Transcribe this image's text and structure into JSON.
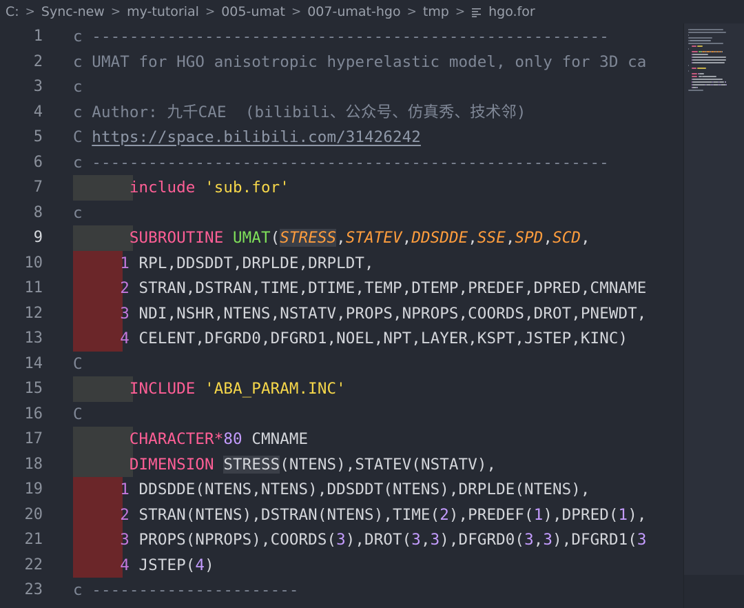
{
  "breadcrumb": {
    "items": [
      "C:",
      "Sync-new",
      "my-tutorial",
      "005-umat",
      "007-umat-hgo",
      "tmp"
    ],
    "separator": ">",
    "file": "hgo.for",
    "file_icon": "file-lines-icon"
  },
  "editor": {
    "active_line": 9,
    "lines": [
      {
        "n": "1",
        "tokens": [
          [
            "c",
            "comment"
          ],
          [
            " -------------------------------------------------------",
            "comment"
          ]
        ]
      },
      {
        "n": "2",
        "tokens": [
          [
            "c UMAT for HGO anisotropic hyperelastic model, only for 3D ca",
            "comment"
          ]
        ]
      },
      {
        "n": "3",
        "tokens": [
          [
            "c",
            "comment"
          ]
        ]
      },
      {
        "n": "4",
        "tokens": [
          [
            "c Author: 九千CAE  (bilibili、公众号、仿真秀、技术邻)",
            "comment"
          ]
        ]
      },
      {
        "n": "5",
        "tokens": [
          [
            "C ",
            "comment"
          ],
          [
            "https://space.bilibili.com/31426242",
            "link"
          ]
        ]
      },
      {
        "n": "6",
        "tokens": [
          [
            "c -------------------------------------------------------",
            "comment"
          ]
        ]
      },
      {
        "n": "7",
        "indent": "gray",
        "tokens": [
          [
            "      ",
            "plain"
          ],
          [
            "include",
            "keyword"
          ],
          [
            " ",
            "plain"
          ],
          [
            "'sub.for'",
            "string"
          ]
        ]
      },
      {
        "n": "8",
        "tokens": [
          [
            "c",
            "comment"
          ]
        ]
      },
      {
        "n": "9",
        "indent": "gray",
        "tokens": [
          [
            "      ",
            "plain"
          ],
          [
            "SUBROUTINE",
            "keyword"
          ],
          [
            " ",
            "plain"
          ],
          [
            "UMAT",
            "func"
          ],
          [
            "(",
            "plain"
          ],
          [
            "STRESS",
            "param-hl"
          ],
          [
            ",",
            "plain"
          ],
          [
            "STATEV",
            "param"
          ],
          [
            ",",
            "plain"
          ],
          [
            "DDSDDE",
            "param"
          ],
          [
            ",",
            "plain"
          ],
          [
            "SSE",
            "param"
          ],
          [
            ",",
            "plain"
          ],
          [
            "SPD",
            "param"
          ],
          [
            ",",
            "plain"
          ],
          [
            "SCD",
            "param"
          ],
          [
            ",",
            "plain"
          ]
        ]
      },
      {
        "n": "10",
        "indent": "red",
        "tokens": [
          [
            "     ",
            "plain"
          ],
          [
            "1",
            "contin"
          ],
          [
            " RPL,DDSDDT,DRPLDE,DRPLDT,",
            "plain"
          ]
        ]
      },
      {
        "n": "11",
        "indent": "red",
        "tokens": [
          [
            "     ",
            "plain"
          ],
          [
            "2",
            "contin"
          ],
          [
            " STRAN,DSTRAN,TIME,DTIME,TEMP,DTEMP,PREDEF,DPRED,CMNAME",
            "plain"
          ]
        ]
      },
      {
        "n": "12",
        "indent": "red",
        "tokens": [
          [
            "     ",
            "plain"
          ],
          [
            "3",
            "contin"
          ],
          [
            " NDI,NSHR,NTENS,NSTATV,PROPS,NPROPS,COORDS,DROT,PNEWDT,",
            "plain"
          ]
        ]
      },
      {
        "n": "13",
        "indent": "red",
        "tokens": [
          [
            "     ",
            "plain"
          ],
          [
            "4",
            "contin"
          ],
          [
            " CELENT,DFGRD0,DFGRD1,NOEL,NPT,LAYER,KSPT,JSTEP,KINC)",
            "plain"
          ]
        ]
      },
      {
        "n": "14",
        "tokens": [
          [
            "C",
            "comment"
          ]
        ]
      },
      {
        "n": "15",
        "indent": "gray",
        "tokens": [
          [
            "      ",
            "plain"
          ],
          [
            "INCLUDE",
            "keyword"
          ],
          [
            " ",
            "plain"
          ],
          [
            "'ABA_PARAM.INC'",
            "string"
          ]
        ]
      },
      {
        "n": "16",
        "tokens": [
          [
            "C",
            "comment"
          ]
        ]
      },
      {
        "n": "17",
        "indent": "gray",
        "tokens": [
          [
            "      ",
            "plain"
          ],
          [
            "CHARACTER",
            "keyword"
          ],
          [
            "*",
            "keyword"
          ],
          [
            "80",
            "number"
          ],
          [
            " CMNAME",
            "plain"
          ]
        ]
      },
      {
        "n": "18",
        "indent": "gray",
        "tokens": [
          [
            "      ",
            "plain"
          ],
          [
            "DIMENSION",
            "keyword"
          ],
          [
            " ",
            "plain"
          ],
          [
            "STRESS",
            "plain-hl"
          ],
          [
            "(NTENS),STATEV(NSTATV),",
            "plain"
          ]
        ]
      },
      {
        "n": "19",
        "indent": "red",
        "tokens": [
          [
            "     ",
            "plain"
          ],
          [
            "1",
            "contin"
          ],
          [
            " DDSDDE(NTENS,NTENS),DDSDDT(NTENS),DRPLDE(NTENS),",
            "plain"
          ]
        ]
      },
      {
        "n": "20",
        "indent": "red",
        "tokens": [
          [
            "     ",
            "plain"
          ],
          [
            "2",
            "contin"
          ],
          [
            " STRAN(NTENS),DSTRAN(NTENS),TIME(",
            "plain"
          ],
          [
            "2",
            "number"
          ],
          [
            "),PREDEF(",
            "plain"
          ],
          [
            "1",
            "number"
          ],
          [
            "),DPRED(",
            "plain"
          ],
          [
            "1",
            "number"
          ],
          [
            "),",
            "plain"
          ]
        ]
      },
      {
        "n": "21",
        "indent": "red",
        "tokens": [
          [
            "     ",
            "plain"
          ],
          [
            "3",
            "contin"
          ],
          [
            " PROPS(NPROPS),COORDS(",
            "plain"
          ],
          [
            "3",
            "number"
          ],
          [
            "),DROT(",
            "plain"
          ],
          [
            "3",
            "number"
          ],
          [
            ",",
            "plain"
          ],
          [
            "3",
            "number"
          ],
          [
            "),DFGRD0(",
            "plain"
          ],
          [
            "3",
            "number"
          ],
          [
            ",",
            "plain"
          ],
          [
            "3",
            "number"
          ],
          [
            "),DFGRD1(",
            "plain"
          ],
          [
            "3",
            "number"
          ]
        ]
      },
      {
        "n": "22",
        "indent": "red",
        "tokens": [
          [
            "     ",
            "plain"
          ],
          [
            "4",
            "contin"
          ],
          [
            " JSTEP(",
            "plain"
          ],
          [
            "4",
            "number"
          ],
          [
            ")",
            "plain"
          ]
        ]
      },
      {
        "n": "23",
        "tokens": [
          [
            "c ----------------------",
            "comment"
          ]
        ]
      }
    ]
  },
  "colors": {
    "background": "#262a33",
    "keyword": "#ff5f96",
    "function": "#7fe05a",
    "string": "#f6d74a",
    "number": "#c49cff",
    "parameter": "#ff9d3d",
    "comment": "#7f8796",
    "indent_error": "#6b2629",
    "indent_guide": "#3a3d3d"
  }
}
